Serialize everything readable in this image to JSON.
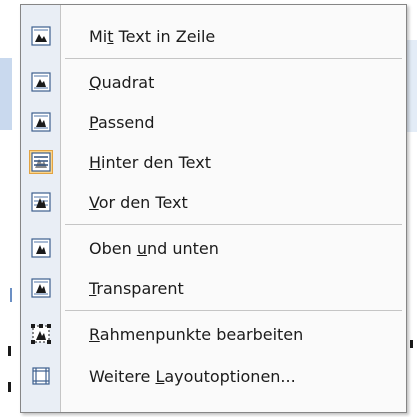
{
  "menu": {
    "items": [
      {
        "label_pre": "Mi",
        "accel": "t",
        "label_post": " Text in Zeile",
        "icon": "inline-with-text-icon",
        "checked": false
      },
      {
        "label_pre": "",
        "accel": "Q",
        "label_post": "uadrat",
        "icon": "square-wrap-icon",
        "checked": false
      },
      {
        "label_pre": "",
        "accel": "P",
        "label_post": "assend",
        "icon": "tight-wrap-icon",
        "checked": false
      },
      {
        "label_pre": "",
        "accel": "H",
        "label_post": "inter den Text",
        "icon": "behind-text-icon",
        "checked": true
      },
      {
        "label_pre": "",
        "accel": "V",
        "label_post": "or den Text",
        "icon": "in-front-of-text-icon",
        "checked": false
      },
      {
        "label_pre": "Oben ",
        "accel": "u",
        "label_post": "nd unten",
        "icon": "top-and-bottom-icon",
        "checked": false
      },
      {
        "label_pre": "",
        "accel": "T",
        "label_post": "ransparent",
        "icon": "through-wrap-icon",
        "checked": false
      },
      {
        "label_pre": "",
        "accel": "R",
        "label_post": "ahmenpunkte bearbeiten",
        "icon": "edit-wrap-points-icon",
        "checked": false
      },
      {
        "label_pre": "Weitere ",
        "accel": "L",
        "label_post": "ayoutoptionen...",
        "icon": "more-layout-options-icon",
        "checked": false
      }
    ],
    "accent_checked": "#fbd58a",
    "accent_checked_border": "#e2a341"
  }
}
